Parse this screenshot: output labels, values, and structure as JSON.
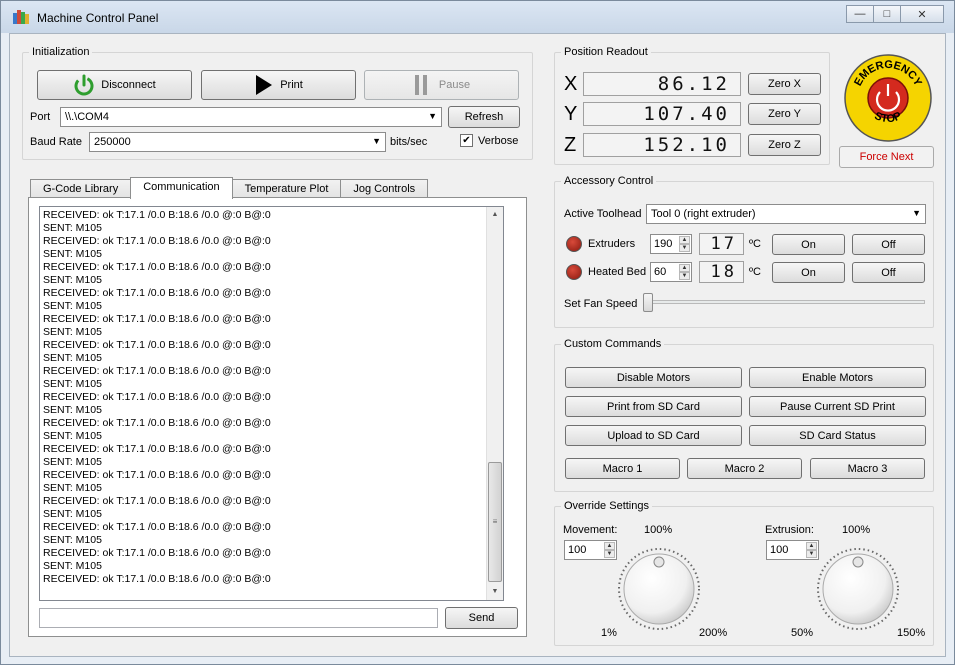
{
  "window": {
    "title": "Machine Control Panel",
    "minimize": "—",
    "maximize": "□",
    "close": "✕"
  },
  "initialization": {
    "title": "Initialization",
    "disconnect_label": "Disconnect",
    "print_label": "Print",
    "pause_label": "Pause",
    "port_label": "Port",
    "port_value": "\\\\.\\COM4",
    "refresh_label": "Refresh",
    "baud_label": "Baud Rate",
    "baud_value": "250000",
    "baud_unit": "bits/sec",
    "verbose_label": "Verbose",
    "verbose_checked": true,
    "check_mark": "✔"
  },
  "position": {
    "title": "Position Readout",
    "x_label": "X",
    "x_value": "86.12",
    "zero_x": "Zero X",
    "y_label": "Y",
    "y_value": "107.40",
    "zero_y": "Zero Y",
    "z_label": "Z",
    "z_value": "152.10",
    "zero_z": "Zero Z"
  },
  "emergency": {
    "top_text": "EMERGENCY",
    "bottom_text": "STOP",
    "force_next_label": "Force Next",
    "force_next_color": "#cc0000"
  },
  "tabs": [
    {
      "label": "G-Code Library"
    },
    {
      "label": "Communication"
    },
    {
      "label": "Temperature Plot"
    },
    {
      "label": "Jog Controls"
    }
  ],
  "log": {
    "lines": [
      "RECEIVED: ok T:17.1 /0.0 B:18.6 /0.0 @:0 B@:0",
      "SENT: M105",
      "RECEIVED: ok T:17.1 /0.0 B:18.6 /0.0 @:0 B@:0",
      "SENT: M105",
      "RECEIVED: ok T:17.1 /0.0 B:18.6 /0.0 @:0 B@:0",
      "SENT: M105",
      "RECEIVED: ok T:17.1 /0.0 B:18.6 /0.0 @:0 B@:0",
      "SENT: M105",
      "RECEIVED: ok T:17.1 /0.0 B:18.6 /0.0 @:0 B@:0",
      "SENT: M105",
      "RECEIVED: ok T:17.1 /0.0 B:18.6 /0.0 @:0 B@:0",
      "SENT: M105",
      "RECEIVED: ok T:17.1 /0.0 B:18.6 /0.0 @:0 B@:0",
      "SENT: M105",
      "RECEIVED: ok T:17.1 /0.0 B:18.6 /0.0 @:0 B@:0",
      "SENT: M105",
      "RECEIVED: ok T:17.1 /0.0 B:18.6 /0.0 @:0 B@:0",
      "SENT: M105",
      "RECEIVED: ok T:17.1 /0.0 B:18.6 /0.0 @:0 B@:0",
      "SENT: M105",
      "RECEIVED: ok T:17.1 /0.0 B:18.6 /0.0 @:0 B@:0",
      "SENT: M105",
      "RECEIVED: ok T:17.1 /0.0 B:18.6 /0.0 @:0 B@:0",
      "SENT: M105",
      "RECEIVED: ok T:17.1 /0.0 B:18.6 /0.0 @:0 B@:0",
      "SENT: M105",
      "RECEIVED: ok T:17.1 /0.0 B:18.6 /0.0 @:0 B@:0",
      "SENT: M105",
      "RECEIVED: ok T:17.1 /0.0 B:18.6 /0.0 @:0 B@:0"
    ],
    "command_value": "",
    "send_label": "Send",
    "scroll_up": "▲",
    "scroll_down": "▼",
    "scroll_grip": "≡"
  },
  "accessory": {
    "title": "Accessory Control",
    "toolhead_label": "Active Toolhead",
    "toolhead_value": "Tool 0 (right extruder)",
    "extruders_label": "Extruders",
    "extruders_setpoint": "190",
    "extruders_current": "17",
    "heatedbed_label": "Heated Bed",
    "heatedbed_setpoint": "60",
    "heatedbed_current": "18",
    "unit": "ºC",
    "on_label": "On",
    "off_label": "Off",
    "fan_label": "Set Fan Speed",
    "fan_speed": 0,
    "spin_up": "▲",
    "spin_down": "▼",
    "combo_arrow": "▼"
  },
  "custom_commands": {
    "title": "Custom Commands",
    "buttons": [
      "Disable Motors",
      "Enable Motors",
      "Print from SD Card",
      "Pause Current SD Print",
      "Upload to SD Card",
      "SD Card Status"
    ],
    "macros": [
      "Macro 1",
      "Macro 2",
      "Macro 3"
    ]
  },
  "override": {
    "title": "Override Settings",
    "movement_label": "Movement:",
    "movement_pct": "100%",
    "movement_value": "100",
    "movement_min": "1%",
    "movement_max": "200%",
    "extrusion_label": "Extrusion:",
    "extrusion_pct": "100%",
    "extrusion_value": "100",
    "extrusion_min": "50%",
    "extrusion_max": "150%"
  },
  "colors": {
    "power_icon": "#2e9e2e",
    "estop_yellow": "#f5d400",
    "estop_red": "#d42a1e"
  }
}
